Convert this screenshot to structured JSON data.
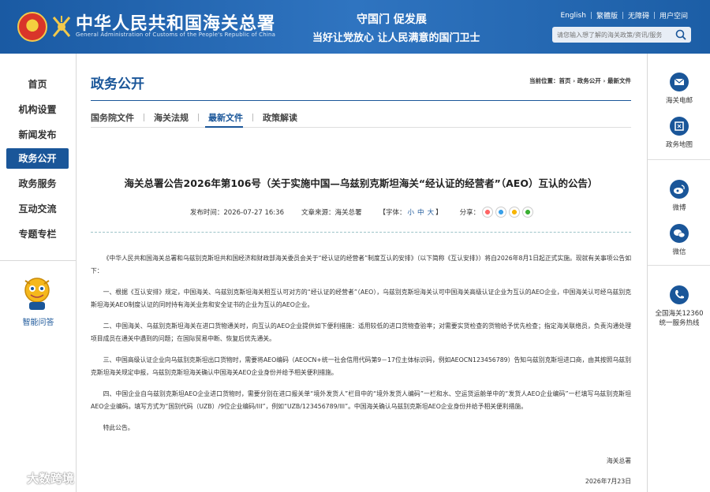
{
  "header": {
    "site_title": "中华人民共和国海关总署",
    "site_subtitle": "General Administration of Customs of the People's Republic of China",
    "slogan_line1": "守国门  促发展",
    "slogan_line2": "当好让党放心  让人民满意的国门卫士",
    "links": [
      "English",
      "繁體版",
      "无障碍",
      "用户空间"
    ],
    "search_placeholder": "请您输入想了解的海关政策/资讯/服务",
    "colors": {
      "header_bg": "#1b5fa8",
      "accent": "#1a5699"
    }
  },
  "left_nav": {
    "items": [
      "首页",
      "机构设置",
      "新闻发布",
      "政务公开",
      "政务服务",
      "互动交流",
      "专题专栏"
    ],
    "active_index": 3,
    "assistant_label": "智能问答"
  },
  "main": {
    "section_title": "政务公开",
    "breadcrumb": "当前位置：首页 › 政务公开 › 最新文件",
    "tabs": [
      "国务院文件",
      "海关法规",
      "最新文件",
      "政策解读"
    ],
    "active_tab": 2,
    "article": {
      "title": "海关总署公告2026年第106号（关于实施中国—乌兹别克斯坦海关“经认证的经营者”（AEO）互认的公告）",
      "publish_time": "发布时间：2026-07-27 16:36",
      "source": "文章来源：海关总署",
      "font_label": "【字体：",
      "font_small": "小",
      "font_mid": "中",
      "font_large": "大",
      "font_close": "】",
      "share_label": "分享：",
      "paragraphs": [
        "《中华人民共和国海关总署和乌兹别克斯坦共和国经济和财政部海关委员会关于“经认证的经营者”制度互认的安排》（以下简称《互认安排》）将自2026年8月1日起正式实施。现就有关事项公告如下：",
        "一、根据《互认安排》规定，中国海关、乌兹别克斯坦海关相互认可对方的“经认证的经营者”（AEO），乌兹别克斯坦海关认可中国海关高级认证企业为互认的AEO企业，中国海关认可经乌兹别克斯坦海关AEO制度认证的同时持有海关业务和安全证书的企业为互认的AEO企业。",
        "二、中国海关、乌兹别克斯坦海关在进口货物通关时，向互认的AEO企业提供如下便利措施：适用较低的进口货物查验率；对需要实货检查的货物给予优先检查；指定海关联络员，负责沟通处理项目成员在通关中遇到的问题；在国际贸易中断、恢复后优先通关。",
        "三、中国高级认证企业向乌兹别克斯坦出口货物时，需要将AEO编码（AEOCN+统一社会信用代码第9－17位主体标识码，例如AEOCN123456789）告知乌兹别克斯坦进口商，由其按照乌兹别克斯坦海关规定申报，乌兹别克斯坦海关确认中国海关AEO企业身份并给予相关便利措施。",
        "四、中国企业自乌兹别克斯坦AEO企业进口货物时，需要分别在进口报关单“境外发货人”栏目中的“境外发货人编码”一栏和水、空运货运舱单中的“发货人AEO企业编码”一栏填写乌兹别克斯坦AEO企业编码。填写方式为“国别代码（UZB）/9位企业编码/III”，例如“UZB/123456789/III”。中国海关确认乌兹别克斯坦AEO企业身份并给予相关便利措施。",
        "特此公告。"
      ],
      "signature": "海关总署",
      "date": "2026年7月23日"
    }
  },
  "right_bar": {
    "items": [
      "海关电邮",
      "政务地图",
      "微博",
      "微信"
    ],
    "hotline_line1": "全国海关12360",
    "hotline_line2": "统一服务热线"
  },
  "watermark": "大数跨境"
}
